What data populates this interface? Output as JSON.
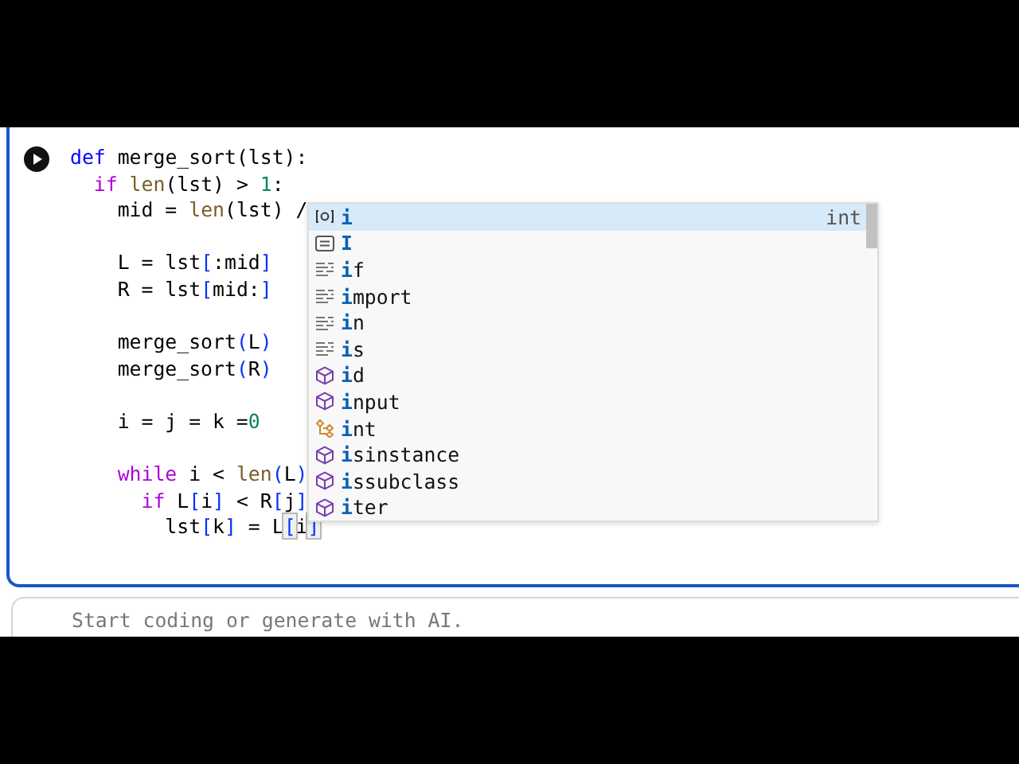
{
  "code_cell": {
    "lines": [
      {
        "kind": "code",
        "tokens": [
          {
            "text": "def",
            "kind": "keyword"
          },
          {
            "text": " merge_sort(lst):",
            "kind": "plain"
          }
        ]
      },
      {
        "kind": "code",
        "tokens": [
          {
            "text": "  if",
            "kind": "control"
          },
          {
            "text": " len",
            "kind": "func"
          },
          {
            "text": "(lst) > ",
            "kind": "plain"
          },
          {
            "text": "1",
            "kind": "number"
          },
          {
            "text": ":",
            "kind": "plain"
          }
        ]
      },
      {
        "kind": "code",
        "tokens": [
          {
            "text": "    mid = ",
            "kind": "plain"
          },
          {
            "text": "len",
            "kind": "func"
          },
          {
            "text": "(lst) /",
            "kind": "plain"
          }
        ]
      },
      {
        "kind": "blank"
      },
      {
        "kind": "code",
        "tokens": [
          {
            "text": "    L = lst",
            "kind": "plain"
          },
          {
            "text": "[",
            "kind": "bracket"
          },
          {
            "text": ":mid",
            "kind": "plain"
          },
          {
            "text": "]",
            "kind": "bracket"
          }
        ]
      },
      {
        "kind": "code",
        "tokens": [
          {
            "text": "    R = lst",
            "kind": "plain"
          },
          {
            "text": "[",
            "kind": "bracket"
          },
          {
            "text": "mid:",
            "kind": "plain"
          },
          {
            "text": "]",
            "kind": "bracket"
          }
        ]
      },
      {
        "kind": "blank"
      },
      {
        "kind": "code",
        "tokens": [
          {
            "text": "    merge_sort",
            "kind": "plain"
          },
          {
            "text": "(",
            "kind": "bracket"
          },
          {
            "text": "L",
            "kind": "plain"
          },
          {
            "text": ")",
            "kind": "bracket"
          }
        ]
      },
      {
        "kind": "code",
        "tokens": [
          {
            "text": "    merge_sort",
            "kind": "plain"
          },
          {
            "text": "(",
            "kind": "bracket"
          },
          {
            "text": "R",
            "kind": "plain"
          },
          {
            "text": ")",
            "kind": "bracket"
          }
        ]
      },
      {
        "kind": "blank"
      },
      {
        "kind": "code",
        "tokens": [
          {
            "text": "    i = j = k =",
            "kind": "plain"
          },
          {
            "text": "0",
            "kind": "number"
          }
        ]
      },
      {
        "kind": "blank"
      },
      {
        "kind": "code",
        "tokens": [
          {
            "text": "    while",
            "kind": "control"
          },
          {
            "text": " i < ",
            "kind": "plain"
          },
          {
            "text": "len",
            "kind": "func"
          },
          {
            "text": "(",
            "kind": "bracket"
          },
          {
            "text": "L",
            "kind": "plain"
          },
          {
            "text": ")",
            "kind": "bracket"
          }
        ]
      },
      {
        "kind": "code",
        "tokens": [
          {
            "text": "      if",
            "kind": "control"
          },
          {
            "text": " L",
            "kind": "plain"
          },
          {
            "text": "[",
            "kind": "bracket"
          },
          {
            "text": "i",
            "kind": "plain"
          },
          {
            "text": "]",
            "kind": "bracket"
          },
          {
            "text": " < R",
            "kind": "plain"
          },
          {
            "text": "[",
            "kind": "bracket"
          },
          {
            "text": "j",
            "kind": "plain"
          },
          {
            "text": "]",
            "kind": "bracket"
          }
        ]
      },
      {
        "kind": "code",
        "tokens": [
          {
            "text": "        lst",
            "kind": "plain"
          },
          {
            "text": "[",
            "kind": "bracket"
          },
          {
            "text": "k",
            "kind": "plain"
          },
          {
            "text": "]",
            "kind": "bracket"
          },
          {
            "text": " = L",
            "kind": "plain"
          },
          {
            "text": "[",
            "kind": "matched"
          },
          {
            "text": "i",
            "kind": "plain"
          },
          {
            "text": "]",
            "kind": "matched"
          }
        ]
      }
    ]
  },
  "suggestions": [
    {
      "kind": "variable",
      "match": "i",
      "detail": "int",
      "selected": true
    },
    {
      "kind": "constant",
      "match": "I",
      "selected": false
    },
    {
      "kind": "keyword",
      "match": "i",
      "rest": "f",
      "selected": false
    },
    {
      "kind": "keyword",
      "match": "i",
      "rest": "mport",
      "selected": false
    },
    {
      "kind": "keyword",
      "match": "i",
      "rest": "n",
      "selected": false
    },
    {
      "kind": "keyword",
      "match": "i",
      "rest": "s",
      "selected": false
    },
    {
      "kind": "function",
      "match": "i",
      "rest": "d",
      "selected": false
    },
    {
      "kind": "function",
      "match": "i",
      "rest": "nput",
      "selected": false
    },
    {
      "kind": "class",
      "match": "i",
      "rest": "nt",
      "selected": false
    },
    {
      "kind": "function",
      "match": "i",
      "rest": "sinstance",
      "selected": false
    },
    {
      "kind": "function",
      "match": "i",
      "rest": "ssubclass",
      "selected": false
    },
    {
      "kind": "function",
      "match": "i",
      "rest": "ter",
      "selected": false
    }
  ],
  "next_cell": {
    "placeholder": "Start coding or generate with AI."
  }
}
